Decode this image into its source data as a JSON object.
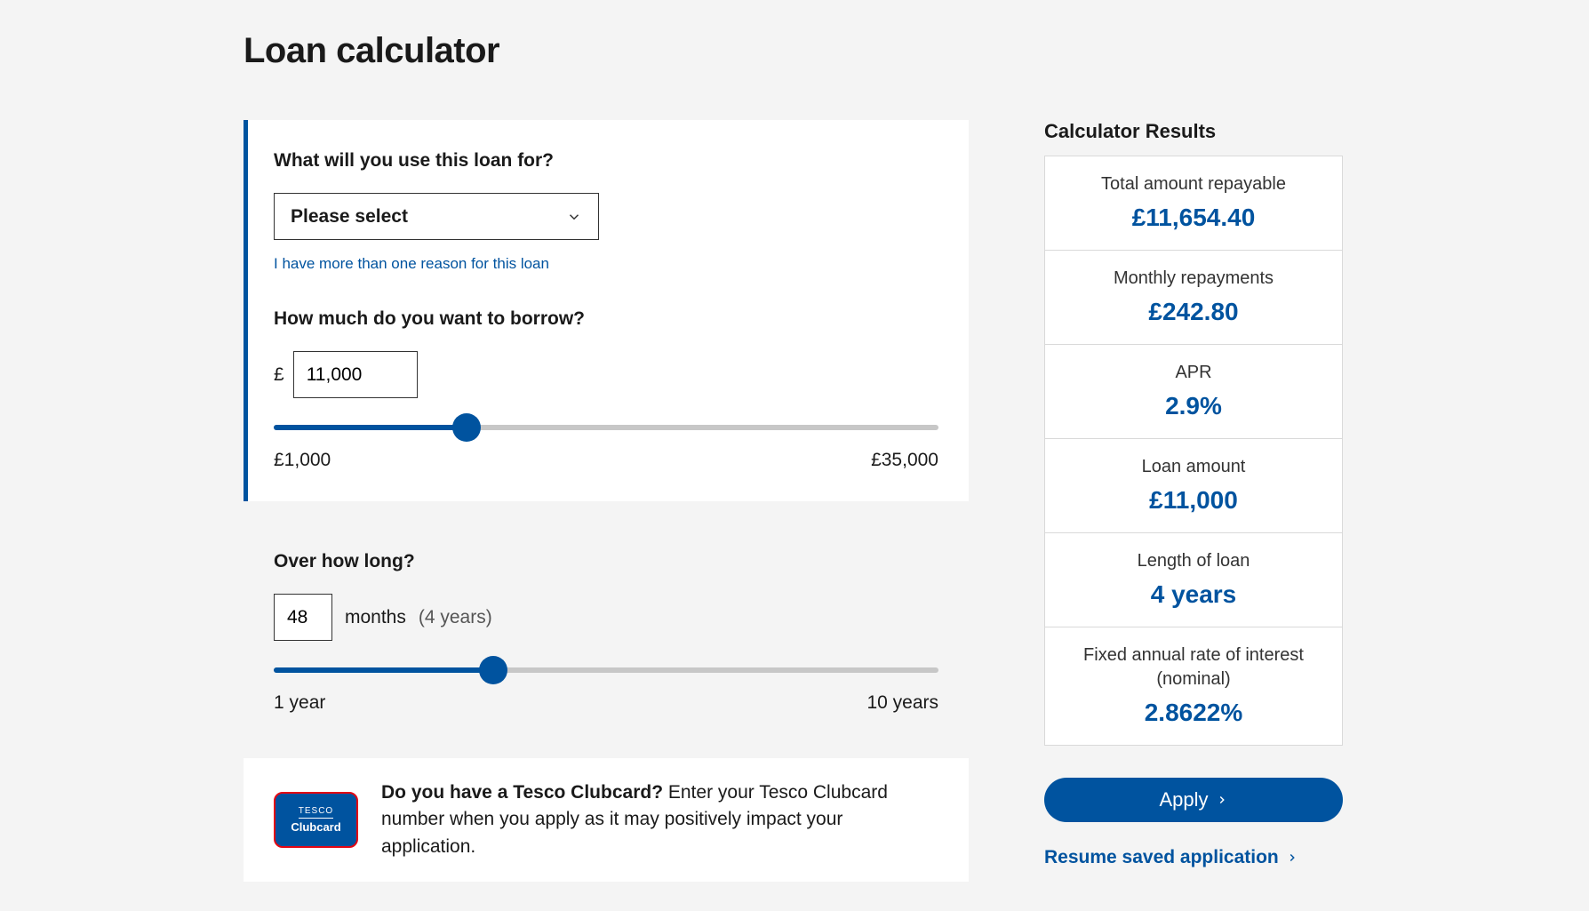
{
  "pageTitle": "Loan calculator",
  "purpose": {
    "question": "What will you use this loan for?",
    "placeholder": "Please select",
    "multiReasonLink": "I have more than one reason for this loan"
  },
  "amount": {
    "question": "How much do you want to borrow?",
    "currency": "£",
    "value": "11,000",
    "minLabel": "£1,000",
    "maxLabel": "£35,000",
    "fillPercent": 29
  },
  "term": {
    "question": "Over how long?",
    "value": "48",
    "unit": "months",
    "yearsHint": "(4 years)",
    "minLabel": "1 year",
    "maxLabel": "10 years",
    "fillPercent": 33
  },
  "clubcard": {
    "brand": "TESCO",
    "sub": "Clubcard",
    "lead": "Do you have a Tesco Clubcard?",
    "rest": " Enter your Tesco Clubcard number when you apply as it may positively impact your application."
  },
  "results": {
    "title": "Calculator Results",
    "rows": [
      {
        "label": "Total amount repayable",
        "value": "£11,654.40"
      },
      {
        "label": "Monthly repayments",
        "value": "£242.80"
      },
      {
        "label": "APR",
        "value": "2.9%"
      },
      {
        "label": "Loan amount",
        "value": "£11,000"
      },
      {
        "label": "Length of loan",
        "value": "4 years"
      },
      {
        "label": "Fixed annual rate of interest (nominal)",
        "value": "2.8622%"
      }
    ]
  },
  "applyLabel": "Apply",
  "resumeLabel": "Resume saved application"
}
